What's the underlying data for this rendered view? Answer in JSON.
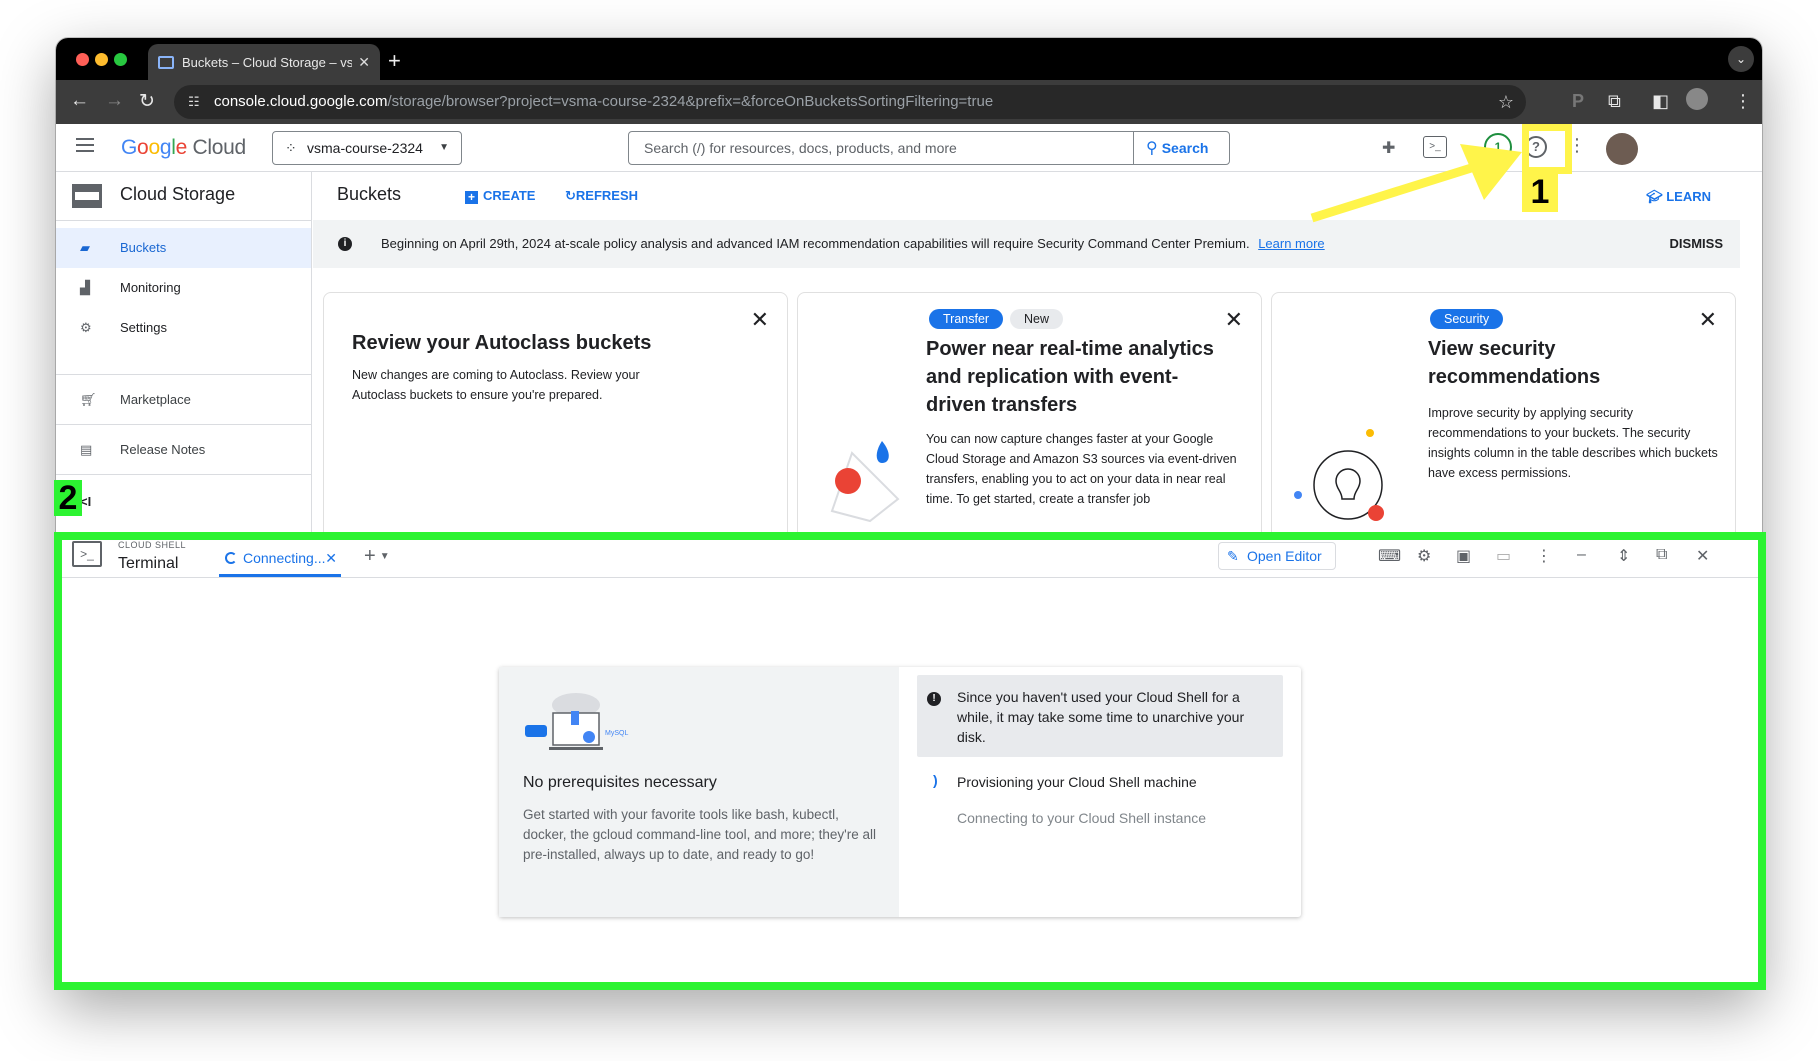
{
  "browser": {
    "tab_title": "Buckets – Cloud Storage – vs",
    "tab_close": "✕",
    "new_tab": "+",
    "url_host": "console.cloud.google.com",
    "url_path": "/storage/browser?project=vsma-course-2324&prefix=&forceOnBucketsSortingFiltering=true"
  },
  "header": {
    "logo_google": "Google",
    "logo_cloud": "Cloud",
    "project": "vsma-course-2324",
    "search_placeholder": "Search (/) for resources, docs, products, and more",
    "search_button": "Search",
    "notifications_count": "1"
  },
  "sidebar": {
    "title": "Cloud Storage",
    "items": [
      {
        "label": "Buckets",
        "icon": "bucket-icon",
        "active": true
      },
      {
        "label": "Monitoring",
        "icon": "chart-icon"
      },
      {
        "label": "Settings",
        "icon": "gear-icon"
      }
    ],
    "extra_items": [
      {
        "label": "Marketplace",
        "icon": "cart-icon"
      },
      {
        "label": "Release Notes",
        "icon": "notes-icon"
      }
    ],
    "collapse_label": "<I"
  },
  "main": {
    "page_title": "Buckets",
    "create_label": "CREATE",
    "refresh_label": "REFRESH",
    "learn_label": "LEARN",
    "banner_text": "Beginning on April 29th, 2024 at-scale policy analysis and advanced IAM recommendation capabilities will require Security Command Center Premium.",
    "banner_link": "Learn more",
    "banner_dismiss": "DISMISS",
    "cards": [
      {
        "title": "Review your Autoclass buckets",
        "body": "New changes are coming to Autoclass. Review your Autoclass buckets to ensure you're prepared."
      },
      {
        "chips": [
          "Transfer",
          "New"
        ],
        "title": "Power near real-time analytics and replication with event-driven transfers",
        "body": "You can now capture changes faster at your Google Cloud Storage and Amazon S3 sources via event-driven transfers, enabling you to act on your data in near real time. To get started, create a transfer job"
      },
      {
        "chips": [
          "Security"
        ],
        "title": "View security recommendations",
        "body": "Improve security by applying security recommendations to your buckets. The security insights column in the table describes which buckets have excess permissions."
      }
    ]
  },
  "shell": {
    "label": "CLOUD SHELL",
    "title": "Terminal",
    "tab_label": "Connecting...",
    "open_editor": "Open Editor",
    "info_title": "No prerequisites necessary",
    "info_body": "Get started with your favorite tools like bash, kubectl, docker, the gcloud command-line tool, and more; they're all pre-installed, always up to date, and ready to go!",
    "notice": "Since you haven't used your Cloud Shell for a while, it may take some time to unarchive your disk.",
    "step_active": "Provisioning your Cloud Shell machine",
    "step_pending": "Connecting to your Cloud Shell instance",
    "illustration_text": "MySQL"
  },
  "annotations": {
    "label_1": "1",
    "label_2": "2",
    "color_yellow": "#fff44a",
    "color_green": "#2cf331"
  }
}
